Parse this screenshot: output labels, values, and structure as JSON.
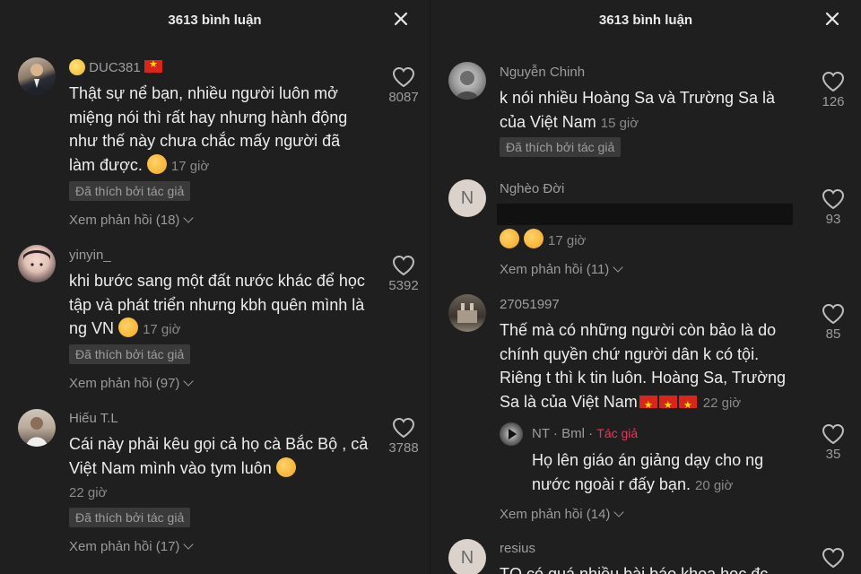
{
  "left": {
    "header_title": "3613 bình luận",
    "comments": [
      {
        "username": "DUC381",
        "text": "Thật sự nể bạn, nhiều người luôn mở miệng nói thì rất hay nhưng hành động như thế này chưa chắc mấy người đã làm được.",
        "time": "17 giờ",
        "badge": "Đã thích bởi tác giả",
        "replies": "Xem phản hồi (18)",
        "likes": "8087"
      },
      {
        "username": "yinyin_",
        "text": "khi bước sang một đất nước khác để học tập và phát triển nhưng kbh quên mình là ng VN",
        "time": "17 giờ",
        "badge": "Đã thích bởi tác giả",
        "replies": "Xem phản hồi (97)",
        "likes": "5392"
      },
      {
        "username": "Hiếu T.L",
        "text": "Cái này phải kêu gọi cả họ cà Bắc Bộ , cả Việt Nam mình vào tym luôn",
        "time": "22 giờ",
        "badge": "Đã thích bởi tác giả",
        "replies": "Xem phản hồi (17)",
        "likes": "3788"
      }
    ]
  },
  "right": {
    "header_title": "3613 bình luận",
    "comments": [
      {
        "username": "Nguyễn Chinh",
        "text": "k nói nhiều Hoàng Sa và Trường Sa là của Việt Nam",
        "time": "15 giờ",
        "badge": "Đã thích bởi tác giả",
        "likes": "126"
      },
      {
        "username": "Nghèo Đời",
        "avatar_letter": "N",
        "time": "17 giờ",
        "replies": "Xem phản hồi (11)",
        "likes": "93"
      },
      {
        "username": "27051997",
        "text": "Thế mà có những người còn bảo là do chính quyền chứ người dân k có tội. Riêng t thì k tin luôn. Hoàng Sa, Trường Sa là của Việt Nam",
        "time": "22 giờ",
        "likes": "85"
      },
      {
        "username": "NT",
        "username_suffix": "Bml",
        "author_tag": "Tác giả",
        "text": "Họ lên giáo án giảng dạy cho ng nước ngoài r đấy bạn.",
        "time": "20 giờ",
        "replies": "Xem phản hồi (14)",
        "likes": "35"
      },
      {
        "username": "resius",
        "avatar_letter": "N",
        "text": "TQ có quá nhiều bài báo khoa học đc"
      }
    ]
  },
  "icons": {
    "close": "close-icon",
    "like": "heart-outline-icon"
  },
  "colors": {
    "background": "#1f1f1f",
    "author_tag": "#fe2c55",
    "flag_red": "#da251d",
    "flag_star": "#ffdf00"
  }
}
